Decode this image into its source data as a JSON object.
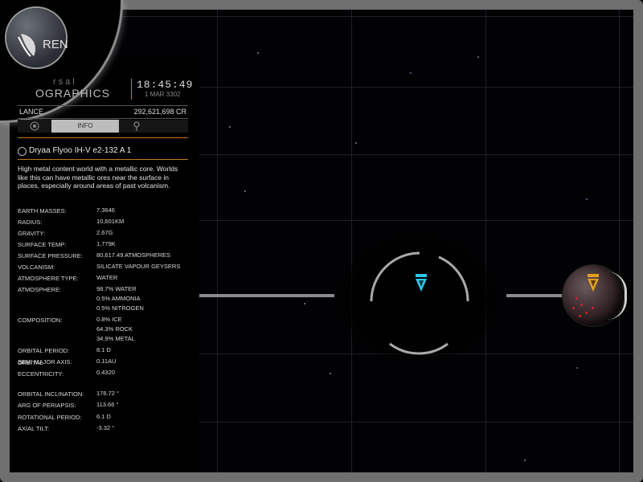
{
  "badge": {
    "text": "REN"
  },
  "header": {
    "brand_top": "rsal",
    "brand_main": "OGRAPHICS",
    "time": "18:45:49",
    "date": "1 MAR 3302"
  },
  "balance": {
    "label": "LANCE",
    "value": "292,621,698 CR"
  },
  "tabs": [
    {
      "label": "",
      "icon": "target-icon"
    },
    {
      "label": "INFO"
    },
    {
      "label": "",
      "icon": "location-pin-icon"
    }
  ],
  "body": {
    "name": "Dryaa Flyoo IH-V e2-132 A 1",
    "description": "High metal content world with a metallic core. Worlds like this can have metallic ores near the surface in places, especially around areas of past volcanism."
  },
  "stats": [
    {
      "label": "EARTH MASSES:",
      "value": [
        "7.3646"
      ]
    },
    {
      "label": "RADIUS:",
      "value": [
        "10,601KM"
      ]
    },
    {
      "label": "GRAVITY:",
      "value": [
        "2.67G"
      ]
    },
    {
      "label": "SURFACE TEMP:",
      "value": [
        "1,779K"
      ]
    },
    {
      "label": "SURFACE PRESSURE:",
      "value": [
        "80,617.49 ATMOSPHERES"
      ]
    },
    {
      "label": "VOLCANISM:",
      "value": [
        "SILICATE VAPOUR GEYSERS"
      ]
    },
    {
      "label": "ATMOSPHERE TYPE:",
      "value": [
        "WATER"
      ]
    },
    {
      "label": "ATMOSPHERE:",
      "value": [
        "98.7% WATER",
        "0.5% AMMONIA",
        "0.5% NITROGEN"
      ]
    },
    {
      "label": "COMPOSITION:",
      "value": [
        "0.8% ICE",
        "64.3% ROCK",
        "34.9% METAL"
      ]
    },
    {
      "label": "ORBITAL PERIOD:",
      "value": [
        "8.1 D"
      ]
    },
    {
      "label": "SEMI MAJOR AXIS:",
      "value": [
        "0.11AU"
      ]
    },
    {
      "label": "ORBITAL\nECCENTRICITY:",
      "value": [
        "0.4320"
      ]
    },
    {
      "label": "ORBITAL INCLINATION:",
      "value": [
        "176.72 °"
      ]
    },
    {
      "label": "ARG OF PERIAPSIS:",
      "value": [
        "113.66 °"
      ]
    },
    {
      "label": "ROTATIONAL PERIOD:",
      "value": [
        "6.1 D"
      ]
    },
    {
      "label": "AXIAL TILT:",
      "value": [
        "-3.32 °"
      ]
    }
  ],
  "colors": {
    "accent": "#c07a20",
    "selected_marker": "#2fc6e8",
    "planet_marker": "#e0a020"
  }
}
